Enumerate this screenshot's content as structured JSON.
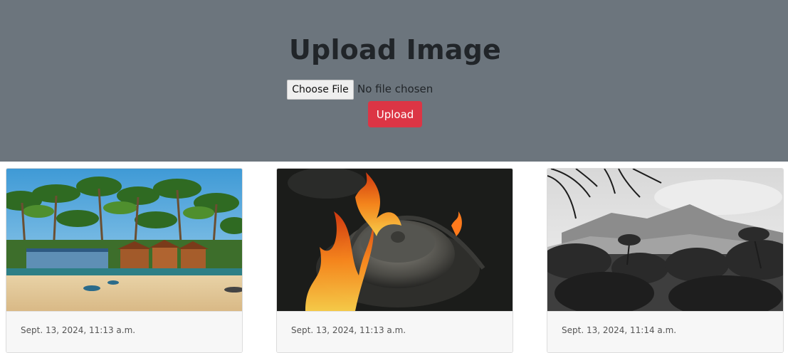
{
  "hero": {
    "title": "Upload Image",
    "choose_file_label": "Choose File",
    "file_status": "No file chosen",
    "upload_label": "Upload"
  },
  "colors": {
    "hero_bg": "#6c757d",
    "upload_button": "#dc3545",
    "card_footer_bg": "#f7f7f7"
  },
  "gallery": [
    {
      "image": "beach-huts-palm-trees-photo",
      "date": "Sept. 13, 2024, 11:13 a.m."
    },
    {
      "image": "kettle-on-fire-photo",
      "date": "Sept. 13, 2024, 11:13 a.m."
    },
    {
      "image": "misty-mountain-palms-bw-photo",
      "date": "Sept. 13, 2024, 11:14 a.m."
    }
  ]
}
